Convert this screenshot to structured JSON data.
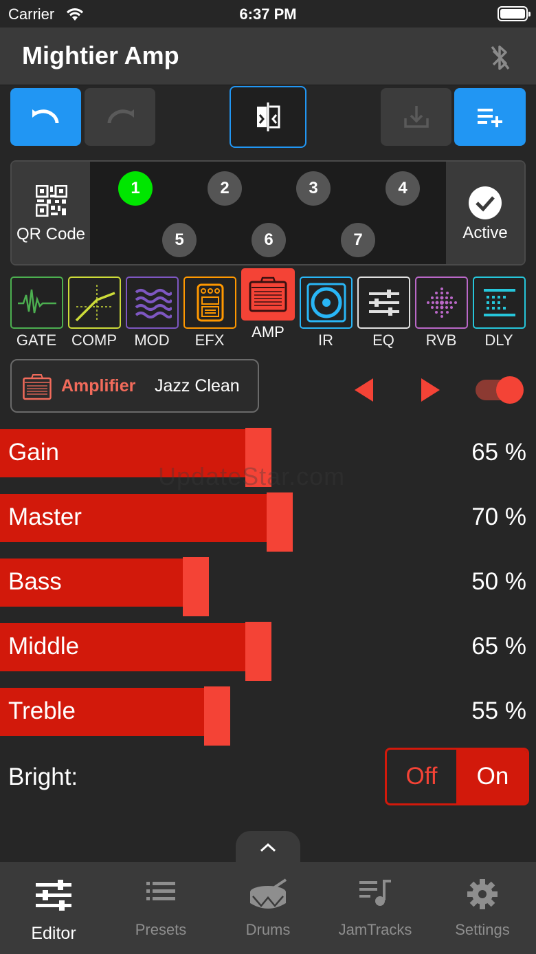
{
  "status_bar": {
    "carrier": "Carrier",
    "time": "6:37 PM"
  },
  "nav": {
    "title": "Mightier Amp"
  },
  "slots_panel": {
    "qr_label": "QR Code",
    "active_label": "Active",
    "slots": [
      "1",
      "2",
      "3",
      "4",
      "5",
      "6",
      "7"
    ],
    "active_slot": "1"
  },
  "fx_chain": [
    {
      "label": "GATE",
      "color": "#4caf50"
    },
    {
      "label": "COMP",
      "color": "#cddc39"
    },
    {
      "label": "MOD",
      "color": "#7e57c2"
    },
    {
      "label": "EFX",
      "color": "#ff9800"
    },
    {
      "label": "AMP",
      "color": "#f44336"
    },
    {
      "label": "IR",
      "color": "#29b6f6"
    },
    {
      "label": "EQ",
      "color": "#e0e0e0"
    },
    {
      "label": "RVB",
      "color": "#ba68c8"
    },
    {
      "label": "DLY",
      "color": "#26c6da"
    }
  ],
  "amp_selector": {
    "type": "Amplifier",
    "name": "Jazz Clean",
    "enabled": true
  },
  "params": [
    {
      "label": "Gain",
      "value_text": "65 %",
      "value": 65
    },
    {
      "label": "Master",
      "value_text": "70 %",
      "value": 70
    },
    {
      "label": "Bass",
      "value_text": "50 %",
      "value": 50
    },
    {
      "label": "Middle",
      "value_text": "65 %",
      "value": 65
    },
    {
      "label": "Treble",
      "value_text": "55 %",
      "value": 55
    }
  ],
  "watermark": "UpdateStar.com",
  "bright": {
    "label": "Bright:",
    "off": "Off",
    "on": "On",
    "selected": "On"
  },
  "tabs": [
    {
      "label": "Editor",
      "selected": true
    },
    {
      "label": "Presets",
      "selected": false
    },
    {
      "label": "Drums",
      "selected": false
    },
    {
      "label": "JamTracks",
      "selected": false
    },
    {
      "label": "Settings",
      "selected": false
    }
  ],
  "colors": {
    "accent_blue": "#2196f3",
    "accent_red": "#f44336",
    "bar_red": "#d2190b",
    "slot_active": "#00e600"
  }
}
